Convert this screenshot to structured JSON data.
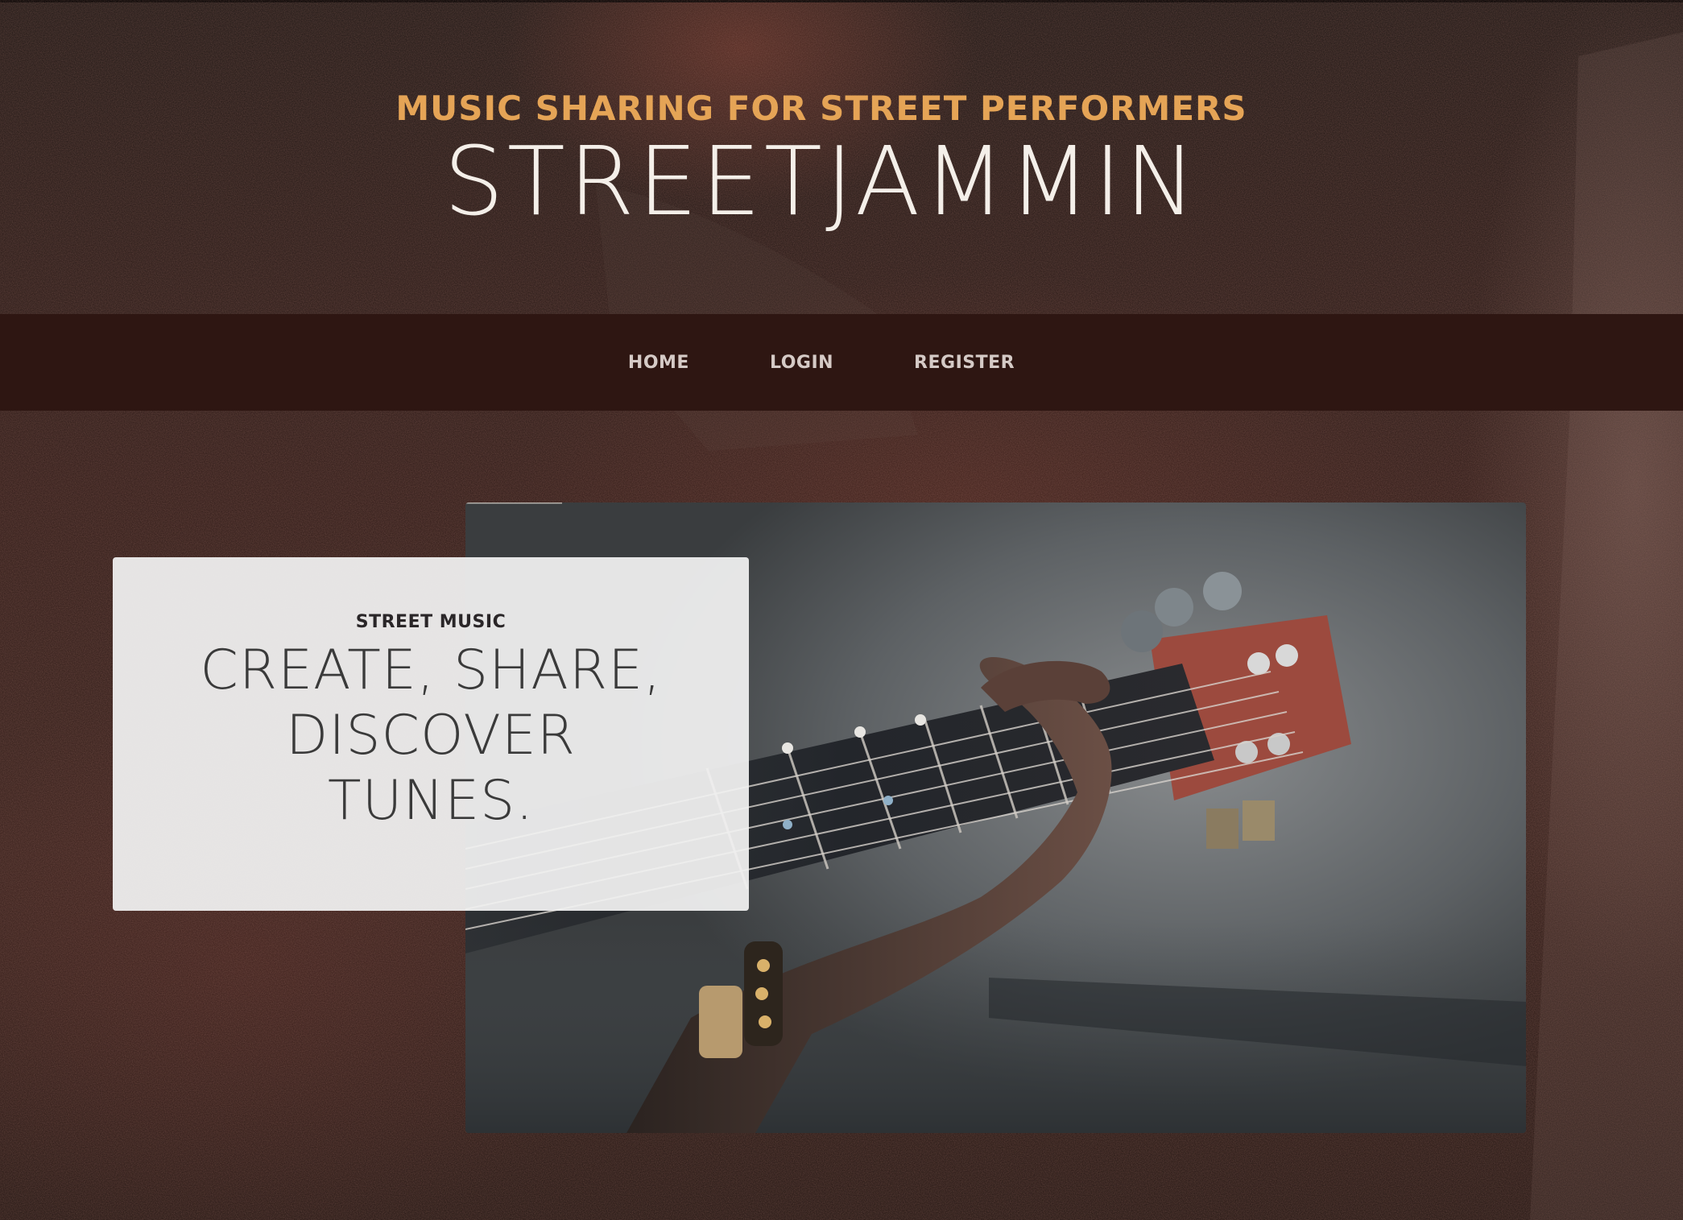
{
  "header": {
    "tagline": "MUSIC SHARING FOR STREET PERFORMERS",
    "brand": "STREETJAMMIN"
  },
  "nav": {
    "items": [
      {
        "label": "HOME"
      },
      {
        "label": "LOGIN"
      },
      {
        "label": "REGISTER"
      }
    ]
  },
  "hero": {
    "kicker": "STREET MUSIC",
    "headline": "CREATE, SHARE, DISCOVER TUNES."
  },
  "colors": {
    "accent": "#e5a456",
    "nav_background": "#2e1612",
    "card_background": "#f0f0f0"
  }
}
